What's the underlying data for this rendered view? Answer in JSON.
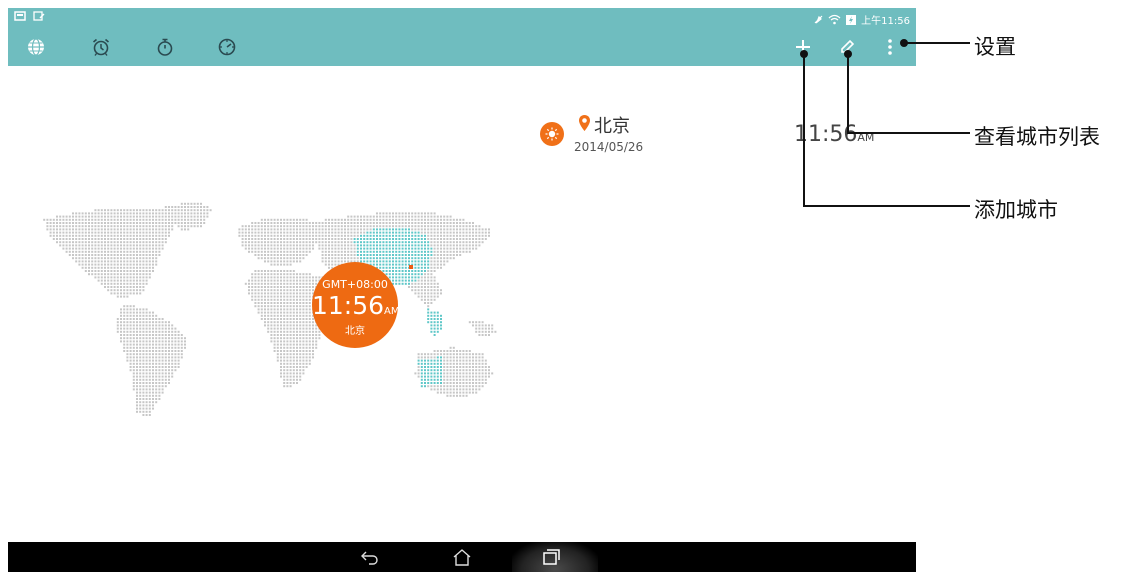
{
  "status_bar": {
    "left_icons": [
      "notification-icon",
      "screenshot-icon"
    ],
    "time": "上午11:56",
    "icons": [
      "mute-icon",
      "wifi-icon",
      "battery-charging-icon"
    ]
  },
  "toolbar": {
    "tabs": [
      {
        "name": "world-clock",
        "icon": "globe-icon"
      },
      {
        "name": "alarm",
        "icon": "alarm-clock-icon"
      },
      {
        "name": "stopwatch",
        "icon": "stopwatch-icon"
      },
      {
        "name": "timer",
        "icon": "timer-icon"
      }
    ],
    "actions": [
      {
        "name": "add-city",
        "icon": "plus-icon"
      },
      {
        "name": "edit-city-list",
        "icon": "pencil-icon"
      },
      {
        "name": "settings",
        "icon": "overflow-menu-icon"
      }
    ],
    "background_color": "#6fbdbf"
  },
  "city": {
    "name": "北京",
    "date": "2014/05/26",
    "time": "11:56",
    "ampm": "AM",
    "weather_icon": "sun-icon"
  },
  "timezone_badge": {
    "offset": "GMT+08:00",
    "time": "11:56",
    "ampm": "AM",
    "city": "北京",
    "color": "#ee6a12"
  },
  "nav_bar": {
    "buttons": [
      {
        "name": "back",
        "icon": "back-icon"
      },
      {
        "name": "home",
        "icon": "home-icon"
      },
      {
        "name": "recents",
        "icon": "recents-icon"
      }
    ]
  },
  "callouts": {
    "settings": "设置",
    "view_city_list": "查看城市列表",
    "add_city": "添加城市"
  }
}
